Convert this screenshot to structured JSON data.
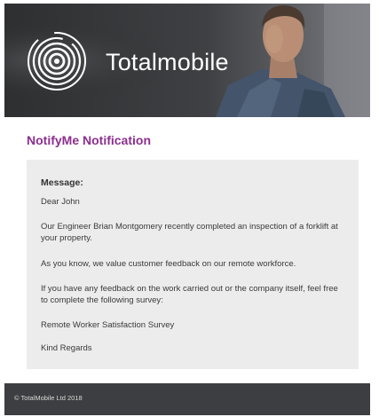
{
  "header": {
    "brand_name": "Totalmobile",
    "logo_icon": "concentric-rings-logo-icon"
  },
  "notification": {
    "title": "NotifyMe Notification"
  },
  "message": {
    "label": "Message:",
    "greeting": "Dear John",
    "paragraph_1": "Our Engineer Brian Montgomery recently completed an inspection of a forklift at your property.",
    "paragraph_2": "As you know, we value customer feedback on our remote workforce.",
    "paragraph_3": "If you have any feedback on the work carried out or the company itself, feel free to complete the following survey:",
    "survey_link": "Remote Worker Satisfaction Survey",
    "sign_off": "Kind Regards"
  },
  "footer": {
    "copyright": "© TotalMobile Ltd 2018"
  },
  "colors": {
    "title_purple": "#8b2f8e",
    "panel_gray": "#ececec",
    "footer_dark": "#3d3e41"
  }
}
